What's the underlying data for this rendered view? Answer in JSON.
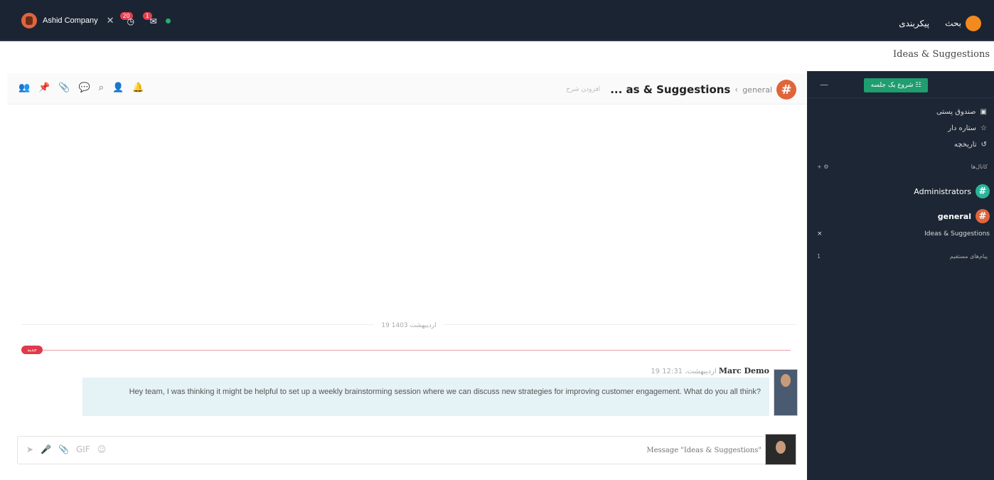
{
  "topbar": {
    "company": "Ashid Company",
    "badge_count_1": "20",
    "badge_count_2": "1",
    "right_items": [
      "پیکربندی",
      "بحث"
    ]
  },
  "subheader": {
    "title": "Ideas & Suggestions"
  },
  "channel_header": {
    "avatar_symbol": "#",
    "parent_channel": "general",
    "separator": "‹",
    "title": "... as & Suggestions",
    "description": "افزودن شرح"
  },
  "messages": {
    "date_separator": "19 اردیبهشت 1403",
    "unread_label": "جدید",
    "items": [
      {
        "author": "Marc Demo",
        "time": "19 اردیبهشت، 12:31",
        "text": "Hey team, I was thinking it might be helpful to set up a weekly brainstorming session where we can discuss new strategies for improving customer engagement. What do you all think?"
      }
    ]
  },
  "composer": {
    "placeholder": "Message \"Ideas & Suggestions\""
  },
  "sidebar": {
    "start_meeting_label": "شروع یک جلسه",
    "inbox": "صندوق پستی",
    "starred": "ستاره دار",
    "history": "تاریخچه",
    "channels_section": "کانال‌ها",
    "channels": [
      {
        "name": "Administrators",
        "color": "#2bb39a",
        "bold": false
      },
      {
        "name": "general",
        "color": "#e0653b",
        "bold": true
      }
    ],
    "sub_channel": "Ideas & Suggestions",
    "direct_section": "پیام‌های مستقیم",
    "direct_count": "1"
  },
  "colors": {
    "topbar": "#1b2433",
    "sidebar": "#1d2634",
    "accent_green": "#1f9e6e",
    "unread_red": "#e03a4a"
  }
}
